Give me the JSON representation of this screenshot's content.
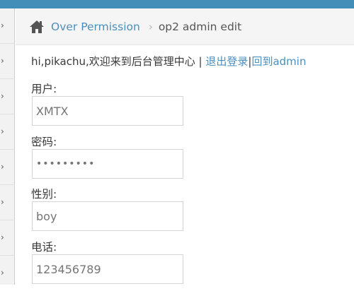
{
  "breadcrumb": {
    "home_icon": "home-icon",
    "parent": "Over Permission",
    "separator": "›",
    "current": "op2 admin edit"
  },
  "welcome": {
    "greeting": "hi,pikachu,欢迎来到后台管理中心",
    "divider": " | ",
    "logout": "退出登录",
    "pipe": "|",
    "back": "回到admin"
  },
  "form": {
    "username": {
      "label": "用户:",
      "value": "XMTX"
    },
    "password": {
      "label": "密码:",
      "value": "•••••••••"
    },
    "gender": {
      "label": "性别:",
      "value": "boy"
    },
    "phone": {
      "label": "电话:",
      "value": "123456789"
    }
  },
  "colors": {
    "topbar": "#438eb9",
    "link": "#4c8fbd"
  }
}
